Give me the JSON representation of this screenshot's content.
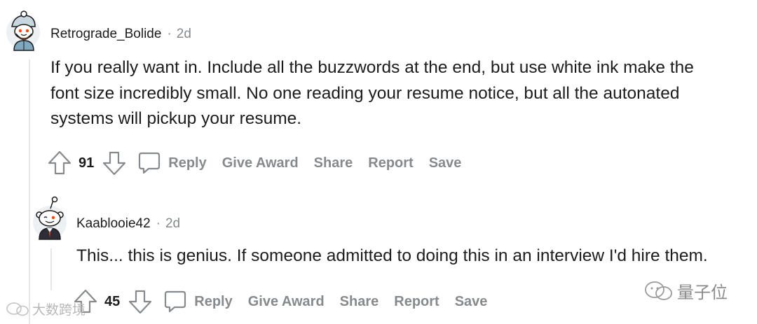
{
  "comments": [
    {
      "author": "Retrograde_Bolide",
      "time": "2d",
      "body_lines": [
        "If you really want in. Include all the buzzwords at the end, but use white ink make the",
        "font size incredibly small. No one reading your resume notice, but all the autonated",
        "systems will pickup your resume."
      ],
      "votes": "91",
      "actions": {
        "reply": "Reply",
        "award": "Give Award",
        "share": "Share",
        "report": "Report",
        "save": "Save"
      }
    },
    {
      "author": "Kaablooie42",
      "time": "2d",
      "body_lines": [
        "This... this is genius. If someone admitted to doing this in an interview I'd hire them."
      ],
      "votes": "45",
      "actions": {
        "reply": "Reply",
        "award": "Give Award",
        "share": "Share",
        "report": "Report",
        "save": "Save"
      }
    }
  ],
  "separator": "·",
  "icons": [
    "upvote-icon",
    "downvote-icon",
    "comment-bubble-icon",
    "snoo-avatar"
  ],
  "colors": {
    "meta_gray": "#878a8c",
    "text": "#1c1c1c",
    "thread_line": "#e6e6e6"
  },
  "watermarks": {
    "left": "大数跨境",
    "right": "量子位"
  }
}
